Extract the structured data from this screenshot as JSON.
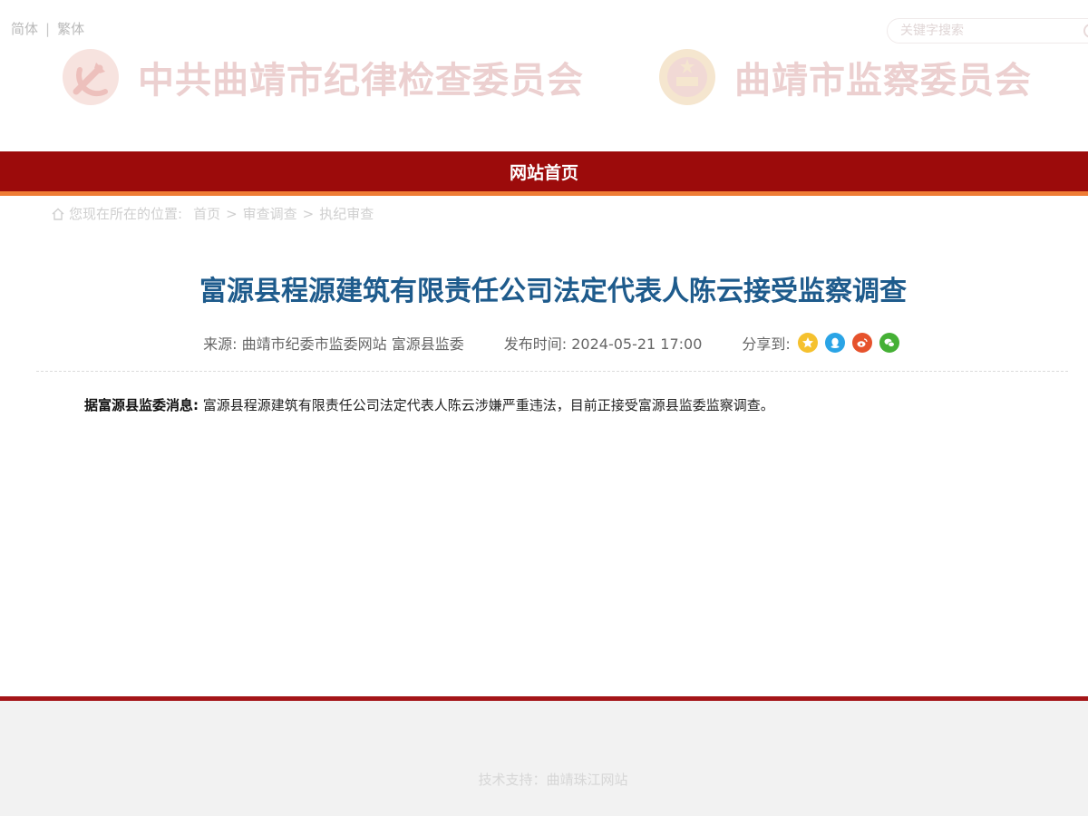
{
  "header": {
    "lang": {
      "simplified": "简体",
      "separator": "|",
      "traditional": "繁体"
    },
    "search": {
      "placeholder": "关键字搜索"
    },
    "left_title": "中共曲靖市纪律检查委员会",
    "right_title": "曲靖市监察委员会"
  },
  "nav": {
    "home_label": "网站首页"
  },
  "breadcrumb": {
    "prefix": "您现在所在的位置:",
    "items": [
      "首页",
      "审查调查",
      "执纪审查"
    ],
    "separator": ">"
  },
  "article": {
    "title": "富源县程源建筑有限责任公司法定代表人陈云接受监察调查",
    "source": "来源: 曲靖市纪委市监委网站 富源县监委",
    "published": "发布时间: 2024-05-21 17:00",
    "share_label": "分享到:",
    "share_icons": [
      "qzone-star-icon",
      "qq-icon",
      "weibo-icon",
      "wechat-icon"
    ],
    "lead": "据富源县监委消息:",
    "body": "富源县程源建筑有限责任公司法定代表人陈云涉嫌严重违法，目前正接受富源县监委监察调查。"
  },
  "footer": {
    "support": "技术支持：曲靖珠江网站"
  },
  "colors": {
    "nav_red": "#9c0b0b",
    "accent_orange": "#ef7d35",
    "title_blue": "#1e5b8c",
    "footer_red": "#a41518"
  }
}
